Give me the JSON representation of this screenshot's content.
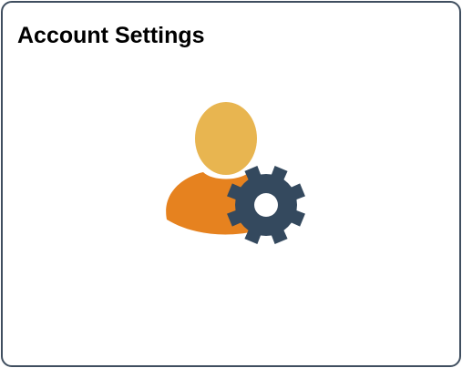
{
  "tile": {
    "title": "Account Settings",
    "icon": "user-settings-icon",
    "colors": {
      "border": "#3f4e5f",
      "head": "#e8b550",
      "body": "#e6821f",
      "gear": "#34495e"
    }
  }
}
